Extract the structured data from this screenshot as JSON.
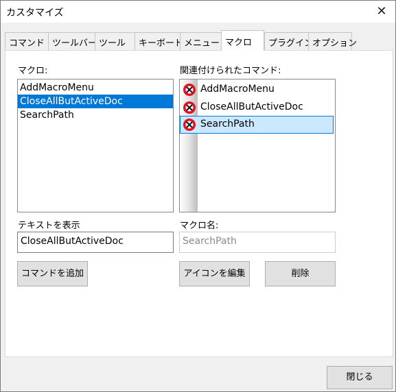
{
  "window": {
    "title": "カスタマイズ",
    "close_glyph": "✕"
  },
  "tabs": [
    {
      "label": "コマンド"
    },
    {
      "label": "ツールバー"
    },
    {
      "label": "ツール"
    },
    {
      "label": "キーボード"
    },
    {
      "label": "メニュー"
    },
    {
      "label": "マクロ",
      "active": true
    },
    {
      "label": "プラグイン"
    },
    {
      "label": "オプション"
    }
  ],
  "macros": {
    "label": "マクロ:",
    "items": [
      "AddMacroMenu",
      "CloseAllButActiveDoc",
      "SearchPath"
    ],
    "selected": "CloseAllButActiveDoc"
  },
  "commands": {
    "label": "関連付けられたコマンド:",
    "items": [
      "AddMacroMenu",
      "CloseAllButActiveDoc",
      "SearchPath"
    ],
    "selected": "SearchPath",
    "icon": "macro-x-icon",
    "icon_colors": {
      "ring": "#e81123",
      "fill": "#ffffff",
      "mark": "#1a1a1a"
    },
    "selection_color": "#cce8ff"
  },
  "display_text": {
    "label": "テキストを表示",
    "value": "CloseAllButActiveDoc"
  },
  "macro_name": {
    "label": "マクロ名:",
    "value": "SearchPath",
    "disabled": true
  },
  "buttons": {
    "add_command": "コマンドを追加",
    "edit_icon": "アイコンを編集",
    "delete": "削除",
    "close": "閉じる"
  },
  "colors": {
    "list_selection": "#0078d7",
    "dialog_bg": "#f0f0f0"
  }
}
